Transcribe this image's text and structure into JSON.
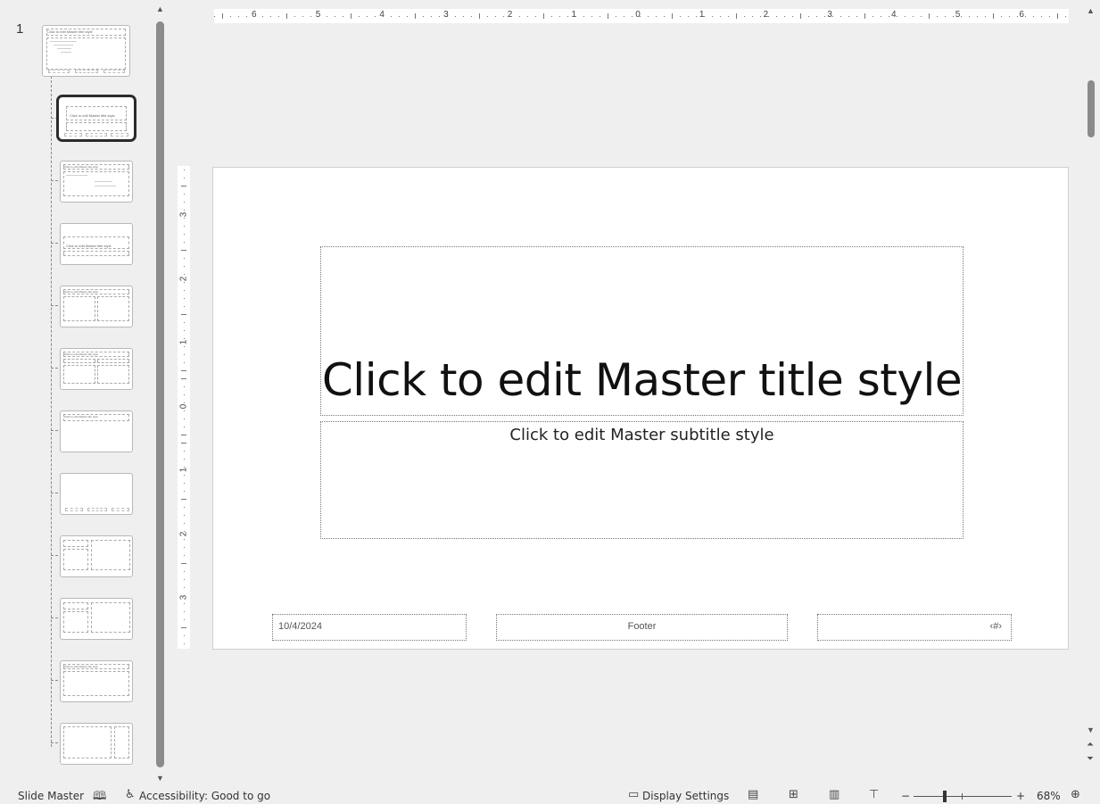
{
  "thumbnails": {
    "slide_number": "1",
    "master_title": "Click to edit Master title style",
    "layouts": [
      {
        "title": "Click to edit Master title style"
      },
      {
        "title": "Click to edit Master title style"
      },
      {
        "title": "Click to edit Master title style"
      },
      {
        "title": "Click to edit Master title style"
      },
      {
        "title": "Click to edit Master title style"
      },
      {
        "title": "Click to edit Master title style"
      },
      {
        "title": ""
      },
      {
        "title": ""
      },
      {
        "title": ""
      },
      {
        "title": "Click to edit Master title style"
      },
      {
        "title": ""
      }
    ],
    "selected_index": 0
  },
  "ruler": {
    "horizontal": [
      "6",
      "5",
      "4",
      "3",
      "2",
      "1",
      "0",
      "1",
      "2",
      "3",
      "4",
      "5",
      "6"
    ],
    "vertical": [
      "3",
      "2",
      "1",
      "0",
      "1",
      "2",
      "3"
    ]
  },
  "slide": {
    "title": "Click to edit Master title style",
    "subtitle": "Click to edit Master subtitle style",
    "date": "10/4/2024",
    "footer": "Footer",
    "slide_number": "‹#›"
  },
  "status_bar": {
    "view_name": "Slide Master",
    "accessibility": "Accessibility: Good to go",
    "display_settings": "Display Settings",
    "zoom_minus": "−",
    "zoom_plus": "+",
    "zoom_level": "68%"
  },
  "icons": {
    "notes": "notes-icon",
    "accessibility": "accessibility-icon",
    "display": "display-settings-icon",
    "normal_view": "normal-view-icon",
    "sorter_view": "slide-sorter-icon",
    "reading_view": "reading-view-icon",
    "presenter_view": "slideshow-icon",
    "fit": "fit-to-window-icon"
  }
}
